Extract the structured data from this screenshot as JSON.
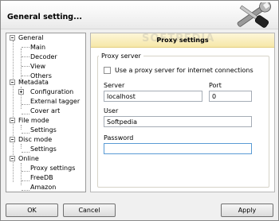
{
  "window": {
    "title": "General setting..."
  },
  "tree": {
    "items": [
      {
        "label": "General",
        "expander": "minus"
      },
      {
        "label": "Main"
      },
      {
        "label": "Decoder"
      },
      {
        "label": "View"
      },
      {
        "label": "Others"
      },
      {
        "label": "Metadata",
        "expander": "minus"
      },
      {
        "label": "Configuration",
        "expander": "plus"
      },
      {
        "label": "External tagger"
      },
      {
        "label": "Cover art"
      },
      {
        "label": "File mode",
        "expander": "minus"
      },
      {
        "label": "Settings"
      },
      {
        "label": "Disc mode",
        "expander": "minus"
      },
      {
        "label": "Settings"
      },
      {
        "label": "Online",
        "expander": "minus"
      },
      {
        "label": "Proxy settings"
      },
      {
        "label": "FreeDB"
      },
      {
        "label": "Amazon"
      }
    ]
  },
  "panel": {
    "title": "Proxy settings",
    "watermark": "SOFTPEDIA",
    "group_label": "Proxy server",
    "use_proxy_label": "Use a proxy server for internet connections",
    "use_proxy_checked": false,
    "server_label": "Server",
    "server_value": "localhost",
    "port_label": "Port",
    "port_value": "0",
    "user_label": "User",
    "user_value": "Softpedia",
    "password_label": "Password",
    "password_value": ""
  },
  "buttons": {
    "ok": "OK",
    "cancel": "Cancel",
    "apply": "Apply"
  },
  "colors": {
    "header_yellow": "#f6e7a8",
    "focus_blue": "#5a9bd5"
  }
}
